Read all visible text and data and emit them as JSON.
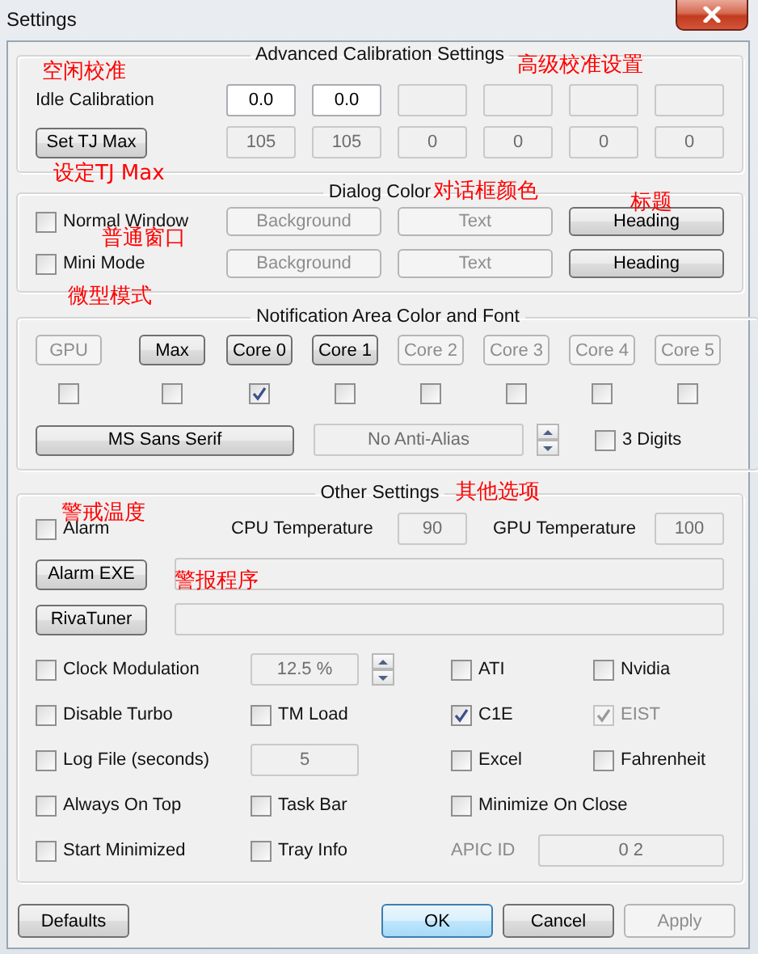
{
  "window": {
    "title": "Settings"
  },
  "advanced_calibration": {
    "title": "Advanced Calibration Settings",
    "idle_label": "Idle Calibration",
    "idle_values": [
      {
        "value": "0.0",
        "enabled": true
      },
      {
        "value": "0.0",
        "enabled": true
      },
      {
        "enabled": false
      },
      {
        "enabled": false
      },
      {
        "enabled": false
      },
      {
        "enabled": false
      }
    ],
    "tj_max_button": "Set TJ Max",
    "tj_max_values": [
      "105",
      "105",
      "0",
      "0",
      "0",
      "0"
    ]
  },
  "dialog_color": {
    "title": "Dialog Color",
    "rows": [
      {
        "label": "Normal Window",
        "checked": false,
        "buttons": [
          {
            "label": "Background",
            "enabled": false
          },
          {
            "label": "Text",
            "enabled": false
          },
          {
            "label": "Heading",
            "enabled": true
          }
        ]
      },
      {
        "label": "Mini Mode",
        "checked": false,
        "buttons": [
          {
            "label": "Background",
            "enabled": false
          },
          {
            "label": "Text",
            "enabled": false
          },
          {
            "label": "Heading",
            "enabled": true
          }
        ]
      }
    ]
  },
  "notification": {
    "title": "Notification Area Color and Font",
    "items": [
      {
        "label": "GPU",
        "enabled": false,
        "checked": false
      },
      {
        "label": "Max",
        "enabled": true,
        "checked": false
      },
      {
        "label": "Core 0",
        "enabled": true,
        "checked": true
      },
      {
        "label": "Core 1",
        "enabled": true,
        "checked": false
      },
      {
        "label": "Core 2",
        "enabled": false,
        "checked": false
      },
      {
        "label": "Core 3",
        "enabled": false,
        "checked": false
      },
      {
        "label": "Core 4",
        "enabled": false,
        "checked": false
      },
      {
        "label": "Core 5",
        "enabled": false,
        "checked": false
      }
    ],
    "font_button": "MS Sans Serif",
    "anti_alias": "No Anti-Alias",
    "three_digits": {
      "label": "3 Digits",
      "checked": false
    }
  },
  "other_settings": {
    "title": "Other Settings",
    "alarm": {
      "label": "Alarm",
      "checked": false
    },
    "cpu_temperature": {
      "label": "CPU Temperature",
      "value": "90"
    },
    "gpu_temperature": {
      "label": "GPU Temperature",
      "value": "100"
    },
    "program_buttons": [
      "Alarm EXE",
      "RivaTuner"
    ],
    "option_rows": [
      [
        {
          "kind": "checkbox",
          "label": "Clock Modulation",
          "checked": false,
          "disabled": false
        },
        {
          "kind": "spin-field",
          "value": "12.5 %"
        },
        {
          "kind": "checkbox",
          "label": "ATI",
          "checked": false,
          "disabled": false
        },
        {
          "kind": "checkbox",
          "label": "Nvidia",
          "checked": false,
          "disabled": false
        }
      ],
      [
        {
          "kind": "checkbox",
          "label": "Disable Turbo",
          "checked": false,
          "disabled": false
        },
        {
          "kind": "checkbox",
          "label": "TM Load",
          "checked": false,
          "disabled": false
        },
        {
          "kind": "checkbox",
          "label": "C1E",
          "checked": true,
          "disabled": false
        },
        {
          "kind": "checkbox",
          "label": "EIST",
          "checked": true,
          "disabled": true
        }
      ],
      [
        {
          "kind": "checkbox",
          "label": "Log File (seconds)",
          "checked": false,
          "disabled": false
        },
        {
          "kind": "field",
          "value": "5"
        },
        {
          "kind": "checkbox",
          "label": "Excel",
          "checked": false,
          "disabled": false
        },
        {
          "kind": "checkbox",
          "label": "Fahrenheit",
          "checked": false,
          "disabled": false
        }
      ],
      [
        {
          "kind": "checkbox",
          "label": "Always On Top",
          "checked": false,
          "disabled": false
        },
        {
          "kind": "checkbox",
          "label": "Task Bar",
          "checked": false,
          "disabled": false
        },
        {
          "kind": "checkbox",
          "label": "Minimize On Close",
          "checked": false,
          "disabled": false
        }
      ],
      [
        {
          "kind": "checkbox",
          "label": "Start Minimized",
          "checked": false,
          "disabled": false
        },
        {
          "kind": "checkbox",
          "label": "Tray Info",
          "checked": false,
          "disabled": false
        },
        {
          "kind": "label-field",
          "label": "APIC ID",
          "value": "0 2"
        }
      ]
    ]
  },
  "buttons": [
    {
      "label": "Defaults",
      "enabled": true,
      "default": false
    },
    {
      "label": "OK",
      "enabled": true,
      "default": true
    },
    {
      "label": "Cancel",
      "enabled": true,
      "default": false
    },
    {
      "label": "Apply",
      "enabled": false,
      "default": false
    }
  ],
  "annotations": [
    "空闲校准",
    "高级校准设置",
    "设定TJ Max",
    "对话框颜色",
    "标题",
    "普通窗口",
    "微型模式",
    "其他选项",
    "警戒温度",
    "警报程序"
  ]
}
